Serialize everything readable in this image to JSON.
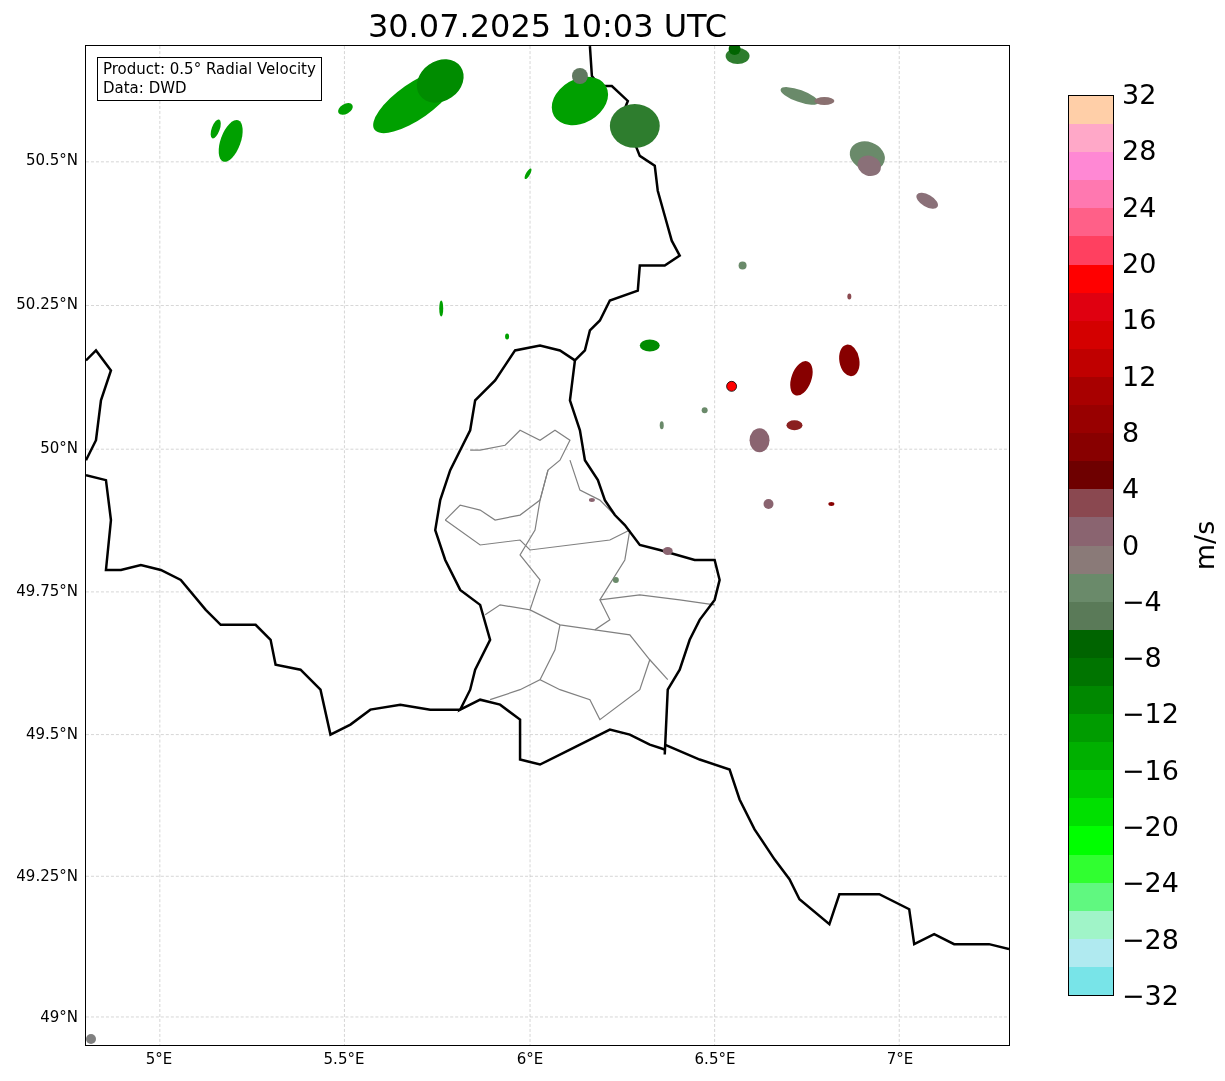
{
  "title": "30.07.2025 10:03 UTC",
  "legend": [
    "Product: 0.5° Radial Velocity",
    "Data: DWD"
  ],
  "y_ticks": [
    "50.5°N",
    "50.25°N",
    "50°N",
    "49.75°N",
    "49.5°N",
    "49.25°N",
    "49°N"
  ],
  "x_ticks": [
    "5°E",
    "5.5°E",
    "6°E",
    "6.5°E",
    "7°E"
  ],
  "colorbar": {
    "label": "m/s",
    "ticks": [
      "32",
      "28",
      "24",
      "20",
      "16",
      "12",
      "8",
      "4",
      "0",
      "−4",
      "−8",
      "−12",
      "−16",
      "−20",
      "−24",
      "−28",
      "−32"
    ],
    "bands": [
      {
        "color": "#ffcfa8"
      },
      {
        "color": "#ffa8c8"
      },
      {
        "color": "#ff88d4"
      },
      {
        "color": "#ff78b0"
      },
      {
        "color": "#ff6088"
      },
      {
        "color": "#ff4060"
      },
      {
        "color": "#ff0000"
      },
      {
        "color": "#e00010"
      },
      {
        "color": "#d40000"
      },
      {
        "color": "#c00000"
      },
      {
        "color": "#a80000"
      },
      {
        "color": "#980000"
      },
      {
        "color": "#880000"
      },
      {
        "color": "#6e0000"
      },
      {
        "color": "#8a4850"
      },
      {
        "color": "#8a6470"
      },
      {
        "color": "#8a7a78"
      },
      {
        "color": "#6a8a6a"
      },
      {
        "color": "#5a7a58"
      },
      {
        "color": "#006400"
      },
      {
        "color": "#007400"
      },
      {
        "color": "#008800"
      },
      {
        "color": "#009c00"
      },
      {
        "color": "#00b000"
      },
      {
        "color": "#00c800"
      },
      {
        "color": "#00e000"
      },
      {
        "color": "#00ff00"
      },
      {
        "color": "#30ff30"
      },
      {
        "color": "#60f880"
      },
      {
        "color": "#a0f4c8"
      },
      {
        "color": "#b0eaf0"
      },
      {
        "color": "#78e4e8"
      }
    ]
  }
}
